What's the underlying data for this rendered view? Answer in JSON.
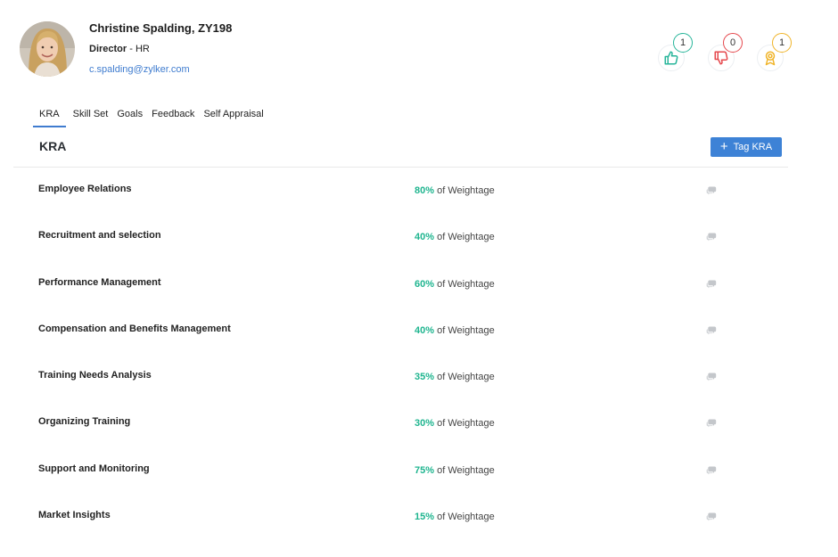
{
  "profile": {
    "name": "Christine Spalding, ZY198",
    "title": "Director",
    "separator": " - ",
    "department": "HR",
    "email": "c.spalding@zylker.com"
  },
  "badges": {
    "likes": "1",
    "dislikes": "0",
    "awards": "1"
  },
  "tabs": [
    {
      "label": "KRA",
      "active": true
    },
    {
      "label": "Skill Set"
    },
    {
      "label": "Goals"
    },
    {
      "label": "Feedback"
    },
    {
      "label": "Self Appraisal"
    }
  ],
  "section": {
    "title": "KRA",
    "tag_button_label": "Tag KRA"
  },
  "weightage_suffix": "of Weightage",
  "kras": [
    {
      "name": "Employee Relations",
      "percent": "80%"
    },
    {
      "name": "Recruitment and selection",
      "percent": "40%"
    },
    {
      "name": "Performance Management",
      "percent": "60%"
    },
    {
      "name": "Compensation and Benefits Management",
      "percent": "40%"
    },
    {
      "name": "Training Needs Analysis",
      "percent": "35%"
    },
    {
      "name": "Organizing Training",
      "percent": "30%"
    },
    {
      "name": "Support and Monitoring",
      "percent": "75%"
    },
    {
      "name": "Market Insights",
      "percent": "15%"
    }
  ],
  "icons": {
    "like": "thumbs-up-icon",
    "dislike": "thumbs-down-icon",
    "award": "award-medal-icon",
    "comment": "comment-icon"
  },
  "colors": {
    "accent_blue": "#3d82d6",
    "percent_green": "#1fb58f",
    "like_teal": "#27b59a",
    "dislike_red": "#e5484d",
    "award_yellow": "#f0b429"
  }
}
